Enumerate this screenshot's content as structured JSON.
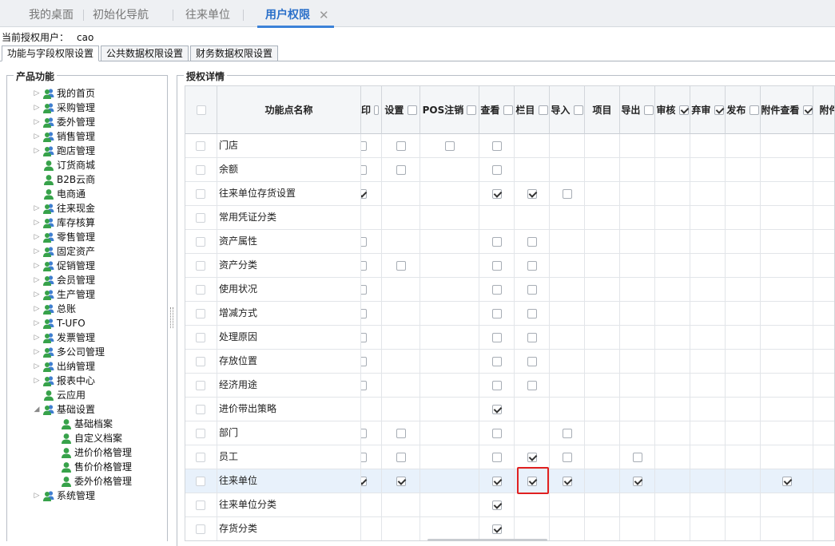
{
  "top_tabs": [
    {
      "label": "我的桌面"
    },
    {
      "label": "初始化导航"
    },
    {
      "label": "往来单位"
    },
    {
      "label": "用户权限",
      "close": "✕"
    }
  ],
  "current_user": {
    "label": "当前授权用户：",
    "value": "cao"
  },
  "sub_tabs": [
    "功能与字段权限设置",
    "公共数据权限设置",
    "财务数据权限设置"
  ],
  "left_panel": {
    "title": "产品功能",
    "tree": [
      {
        "label": "我的首页",
        "expandable": true,
        "icon": "group-icon"
      },
      {
        "label": "采购管理",
        "expandable": true,
        "icon": "group-icon"
      },
      {
        "label": "委外管理",
        "expandable": true,
        "icon": "group-icon"
      },
      {
        "label": "销售管理",
        "expandable": true,
        "icon": "group-icon"
      },
      {
        "label": "跑店管理",
        "expandable": true,
        "icon": "group-icon"
      },
      {
        "label": "订货商城",
        "expandable": false,
        "icon": "user-icon"
      },
      {
        "label": "B2B云商",
        "expandable": false,
        "icon": "user-icon"
      },
      {
        "label": "电商通",
        "expandable": false,
        "icon": "user-icon"
      },
      {
        "label": "往来现金",
        "expandable": true,
        "icon": "group-icon"
      },
      {
        "label": "库存核算",
        "expandable": true,
        "icon": "group-icon"
      },
      {
        "label": "零售管理",
        "expandable": true,
        "icon": "group-icon"
      },
      {
        "label": "固定资产",
        "expandable": true,
        "icon": "group-icon"
      },
      {
        "label": "促销管理",
        "expandable": true,
        "icon": "group-icon"
      },
      {
        "label": "会员管理",
        "expandable": true,
        "icon": "group-icon"
      },
      {
        "label": "生产管理",
        "expandable": true,
        "icon": "group-icon"
      },
      {
        "label": "总账",
        "expandable": true,
        "icon": "group-icon"
      },
      {
        "label": "T-UFO",
        "expandable": true,
        "icon": "group-icon"
      },
      {
        "label": "发票管理",
        "expandable": true,
        "icon": "group-icon"
      },
      {
        "label": "多公司管理",
        "expandable": true,
        "icon": "group-icon"
      },
      {
        "label": "出纳管理",
        "expandable": true,
        "icon": "group-icon"
      },
      {
        "label": "报表中心",
        "expandable": true,
        "icon": "group-icon"
      },
      {
        "label": "云应用",
        "expandable": false,
        "icon": "user-icon"
      },
      {
        "label": "基础设置",
        "expandable": true,
        "expanded": true,
        "icon": "group-icon"
      },
      {
        "label": "基础档案",
        "child": true,
        "icon": "user-icon"
      },
      {
        "label": "自定义档案",
        "child": true,
        "icon": "user-icon"
      },
      {
        "label": "进价价格管理",
        "child": true,
        "icon": "user-icon"
      },
      {
        "label": "售价价格管理",
        "child": true,
        "icon": "user-icon"
      },
      {
        "label": "委外价格管理",
        "child": true,
        "icon": "user-icon"
      },
      {
        "label": "系统管理",
        "expandable": true,
        "icon": "group-icon"
      }
    ]
  },
  "right_panel": {
    "title": "授权详情",
    "columns": [
      {
        "label": "功能点名称"
      },
      {
        "label": "印",
        "header_checked": false
      },
      {
        "label": "设置",
        "header_checked": false
      },
      {
        "label": "POS注销",
        "header_checked": false
      },
      {
        "label": "查看",
        "header_checked": false
      },
      {
        "label": "栏目",
        "header_checked": false
      },
      {
        "label": "导入",
        "header_checked": false
      },
      {
        "label": "项目",
        "header_checked": null
      },
      {
        "label": "导出",
        "header_checked": false
      },
      {
        "label": "审核",
        "header_checked": true
      },
      {
        "label": "弃审",
        "header_checked": true
      },
      {
        "label": "发布",
        "header_checked": false
      },
      {
        "label": "附件查看",
        "header_checked": true
      },
      {
        "label": "附件",
        "header_checked": null
      }
    ],
    "rows": [
      {
        "name": "门店",
        "cells": [
          false,
          false,
          false,
          false,
          null,
          null,
          null,
          null,
          null,
          null,
          null,
          null,
          null
        ]
      },
      {
        "name": "余额",
        "cells": [
          false,
          false,
          null,
          false,
          null,
          null,
          null,
          null,
          null,
          null,
          null,
          null,
          null
        ]
      },
      {
        "name": "往来单位存货设置",
        "cells": [
          true,
          null,
          null,
          true,
          true,
          false,
          null,
          null,
          null,
          null,
          null,
          null,
          null
        ]
      },
      {
        "name": "常用凭证分类",
        "cells": [
          null,
          null,
          null,
          null,
          null,
          null,
          null,
          null,
          null,
          null,
          null,
          null,
          null
        ]
      },
      {
        "name": "资产属性",
        "cells": [
          false,
          null,
          null,
          false,
          false,
          null,
          null,
          null,
          null,
          null,
          null,
          null,
          null
        ]
      },
      {
        "name": "资产分类",
        "cells": [
          false,
          false,
          null,
          false,
          false,
          null,
          null,
          null,
          null,
          null,
          null,
          null,
          null
        ]
      },
      {
        "name": "使用状况",
        "cells": [
          false,
          null,
          null,
          false,
          false,
          null,
          null,
          null,
          null,
          null,
          null,
          null,
          null
        ]
      },
      {
        "name": "增减方式",
        "cells": [
          false,
          null,
          null,
          false,
          false,
          null,
          null,
          null,
          null,
          null,
          null,
          null,
          null
        ]
      },
      {
        "name": "处理原因",
        "cells": [
          false,
          null,
          null,
          false,
          false,
          null,
          null,
          null,
          null,
          null,
          null,
          null,
          null
        ]
      },
      {
        "name": "存放位置",
        "cells": [
          false,
          null,
          null,
          false,
          false,
          null,
          null,
          null,
          null,
          null,
          null,
          null,
          null
        ]
      },
      {
        "name": "经济用途",
        "cells": [
          false,
          null,
          null,
          false,
          false,
          null,
          null,
          null,
          null,
          null,
          null,
          null,
          null
        ]
      },
      {
        "name": "进价带出策略",
        "cells": [
          null,
          null,
          null,
          true,
          null,
          null,
          null,
          null,
          null,
          null,
          null,
          null,
          null
        ]
      },
      {
        "name": "部门",
        "cells": [
          false,
          false,
          null,
          false,
          null,
          false,
          null,
          null,
          null,
          null,
          null,
          null,
          null
        ]
      },
      {
        "name": "员工",
        "cells": [
          false,
          false,
          null,
          false,
          true,
          false,
          null,
          false,
          null,
          null,
          null,
          null,
          null
        ]
      },
      {
        "name": "往来单位",
        "selected": true,
        "cells": [
          true,
          true,
          null,
          true,
          true,
          true,
          null,
          true,
          null,
          null,
          null,
          true,
          null
        ]
      },
      {
        "name": "往来单位分类",
        "cells": [
          null,
          null,
          null,
          true,
          null,
          null,
          null,
          null,
          null,
          null,
          null,
          null,
          null
        ]
      },
      {
        "name": "存货分类",
        "cells": [
          null,
          null,
          null,
          true,
          null,
          null,
          null,
          null,
          null,
          null,
          null,
          null,
          null
        ]
      }
    ]
  },
  "colors": {
    "accent": "#3c82d8",
    "highlight_box": "#e02020",
    "selected_row": "#e8f1fb"
  }
}
